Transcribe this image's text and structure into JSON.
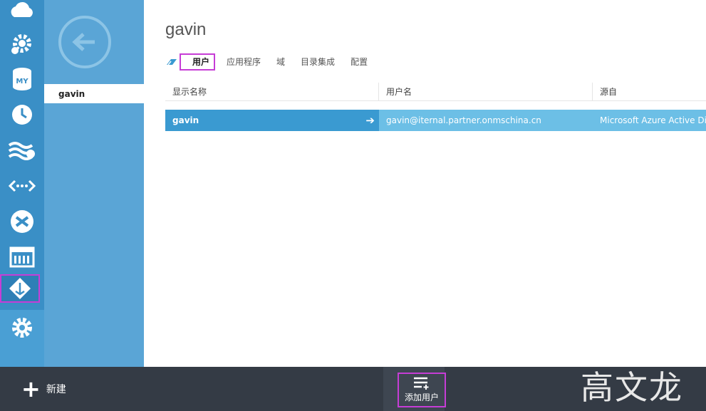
{
  "page": {
    "title": "gavin"
  },
  "subnav": {
    "selected_item": "gavin"
  },
  "tabs": [
    {
      "label": "用户",
      "active": true
    },
    {
      "label": "应用程序"
    },
    {
      "label": "域"
    },
    {
      "label": "目录集成"
    },
    {
      "label": "配置"
    }
  ],
  "table": {
    "headers": [
      "显示名称",
      "用户名",
      "源自"
    ],
    "rows": [
      {
        "display_name": "gavin",
        "username": "gavin@iternal.partner.onmschina.cn",
        "source": "Microsoft Azure Active Dire"
      }
    ]
  },
  "cmdbar": {
    "new_label": "新建",
    "add_user_label": "添加用户"
  },
  "watermark": "高文龙",
  "colors": {
    "rail": "#3a8fc6",
    "subnav": "#5aa5d6",
    "row_selected": "#3a9ad1",
    "row_light": "#6cbfe6",
    "cmdbar": "#343b45",
    "highlight": "#c63dd6"
  },
  "rail_icons": [
    "cloud-icon",
    "cloud-services-icon",
    "mysql-icon",
    "scheduler-icon",
    "hdinsight-icon",
    "api-management-icon",
    "visual-studio-icon",
    "dashboard-icon",
    "active-directory-icon",
    "settings-icon"
  ]
}
